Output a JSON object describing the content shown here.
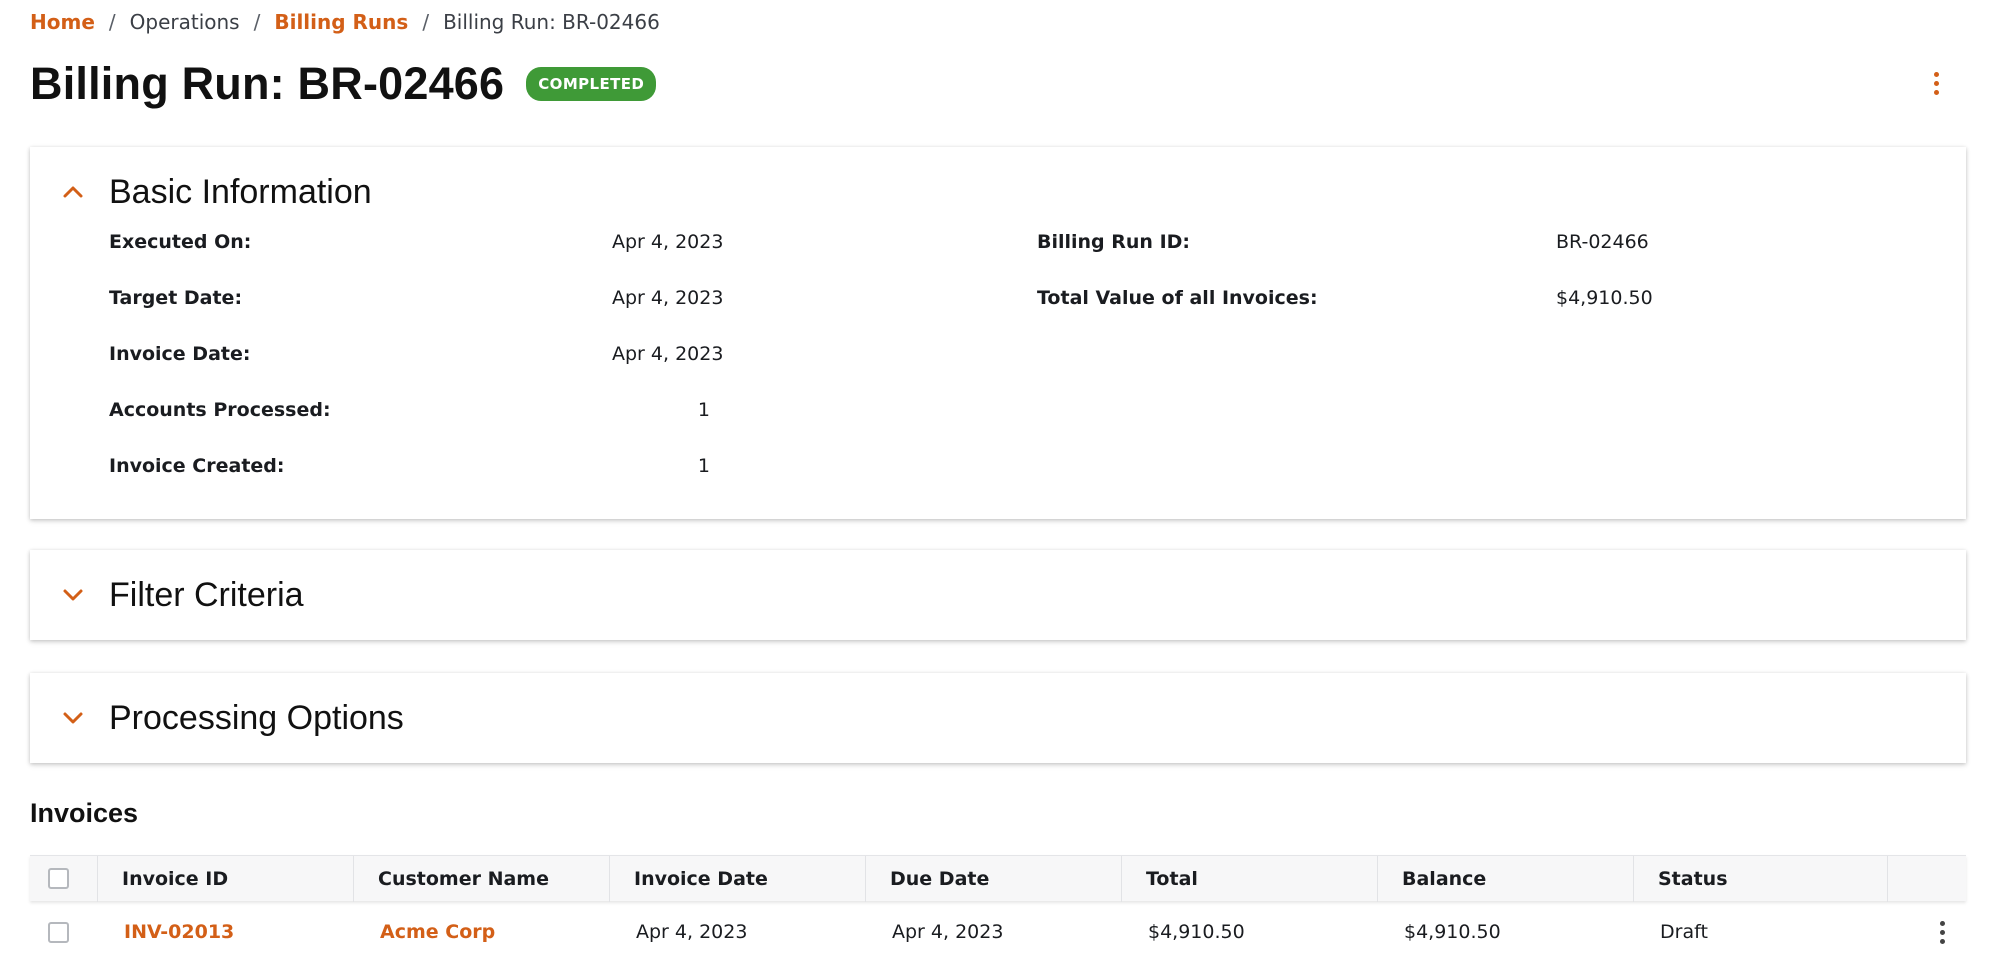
{
  "breadcrumb": {
    "items": [
      {
        "label": "Home"
      },
      {
        "label": "Operations"
      },
      {
        "label": "Billing Runs"
      },
      {
        "label": "Billing Run: BR-02466"
      }
    ],
    "separator": "/"
  },
  "page": {
    "title": "Billing Run: BR-02466",
    "status_badge": "COMPLETED",
    "menu_icon": "more-vertical-icon"
  },
  "colors": {
    "accent": "#d35f17",
    "status_completed": "#3f9a37"
  },
  "basic_information": {
    "title": "Basic Information",
    "expanded": true,
    "left_fields": [
      {
        "label": "Executed On:",
        "value": "Apr 4, 2023"
      },
      {
        "label": "Target Date:",
        "value": "Apr 4, 2023"
      },
      {
        "label": "Invoice Date:",
        "value": "Apr 4, 2023"
      },
      {
        "label": "Accounts Processed:",
        "value": "1"
      },
      {
        "label": "Invoice Created:",
        "value": "1"
      }
    ],
    "right_fields": [
      {
        "label": "Billing Run ID:",
        "value": "BR-02466"
      },
      {
        "label": "Total Value of all Invoices:",
        "value": "$4,910.50"
      }
    ]
  },
  "filter_criteria": {
    "title": "Filter Criteria",
    "expanded": false
  },
  "processing_options": {
    "title": "Processing Options",
    "expanded": false
  },
  "invoices": {
    "title": "Invoices",
    "columns": [
      "Invoice ID",
      "Customer Name",
      "Invoice Date",
      "Due Date",
      "Total",
      "Balance",
      "Status"
    ],
    "rows": [
      {
        "invoice_id": "INV-02013",
        "customer_name": "Acme Corp",
        "invoice_date": "Apr 4, 2023",
        "due_date": "Apr 4, 2023",
        "total": "$4,910.50",
        "balance": "$4,910.50",
        "status": "Draft"
      }
    ]
  }
}
